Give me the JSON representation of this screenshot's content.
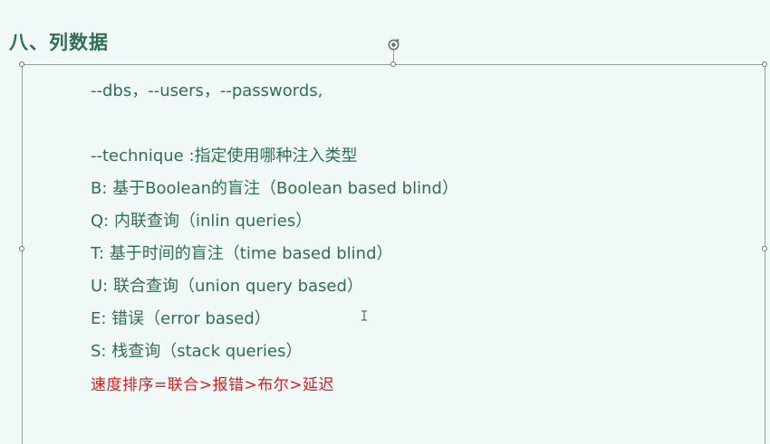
{
  "heading": "八、列数据",
  "lines": [
    "--dbs，--users，--passwords,",
    "--technique :指定使用哪种注入类型",
    "B: 基于Boolean的盲注（Boolean based blind）",
    "Q: 内联查询（inlin queries）",
    "T: 基于时间的盲注（time based blind）",
    "U: 联合查询（union query based）",
    "E: 错误（error based）",
    "S: 栈查询（stack queries）",
    "速度排序=联合>报错>布尔>延迟"
  ],
  "colors": {
    "text": "#2f6f52",
    "highlight": "#d81e1e",
    "background": "#f1f9f8"
  },
  "icons": {
    "rotate": "rotate-handle-icon",
    "cursor": "text-cursor-icon"
  }
}
